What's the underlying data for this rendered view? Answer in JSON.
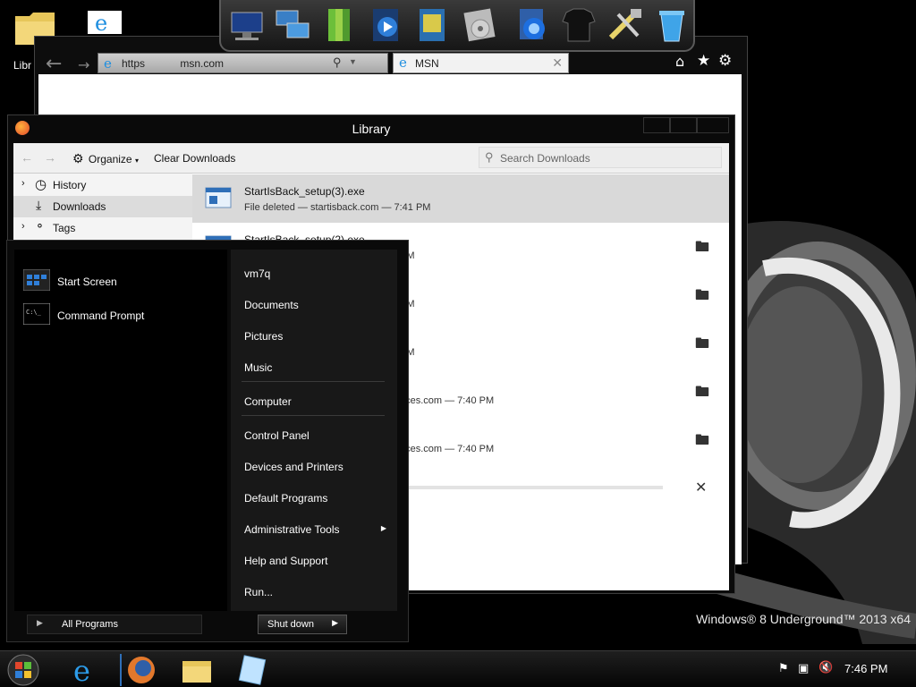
{
  "wallpaper": {
    "watermark": "Windows® 8 Underground™ 2013 x64"
  },
  "desktop_icons": {
    "libraries_label": "Libr"
  },
  "dock": {
    "icons": [
      "computer-icon",
      "network-icon",
      "books-icon",
      "media-player-icon",
      "photo-gallery-icon",
      "dvd-icon",
      "internet-globe-icon",
      "tshirt-icon",
      "tools-icon",
      "recycle-bin-icon"
    ]
  },
  "ie": {
    "address_scheme": "https",
    "address_domain": "msn.com",
    "tab_title": "MSN"
  },
  "library": {
    "title": "Library",
    "organize_label": "Organize",
    "clear_downloads_label": "Clear Downloads",
    "search_placeholder": "Search Downloads",
    "sidebar": [
      {
        "label": "History"
      },
      {
        "label": "Downloads"
      },
      {
        "label": "Tags"
      }
    ],
    "downloads": [
      {
        "name": "StartIsBack_setup(3).exe",
        "status": "File deleted — startisback.com — 7:41 PM"
      },
      {
        "name": "StartIsBack_setup(2).exe",
        "status": "PM"
      },
      {
        "name": "",
        "status": "PM"
      },
      {
        "name": "",
        "status": "PM"
      },
      {
        "name": "",
        "status": "aces.com — 7:40 PM"
      },
      {
        "name": "",
        "status": "aces.com — 7:40 PM"
      }
    ]
  },
  "start_menu": {
    "pinned": [
      {
        "label": "Start Screen"
      },
      {
        "label": "Command Prompt"
      }
    ],
    "right": [
      {
        "label": "vm7q"
      },
      {
        "label": "Documents"
      },
      {
        "label": "Pictures"
      },
      {
        "label": "Music"
      },
      {
        "label": "Computer"
      },
      {
        "label": "Control Panel"
      },
      {
        "label": "Devices and Printers"
      },
      {
        "label": "Default Programs"
      },
      {
        "label": "Administrative Tools"
      },
      {
        "label": "Help and Support"
      },
      {
        "label": "Run..."
      }
    ],
    "all_programs_label": "All Programs",
    "shutdown_label": "Shut down"
  },
  "taskbar": {
    "clock": "7:46 PM"
  }
}
